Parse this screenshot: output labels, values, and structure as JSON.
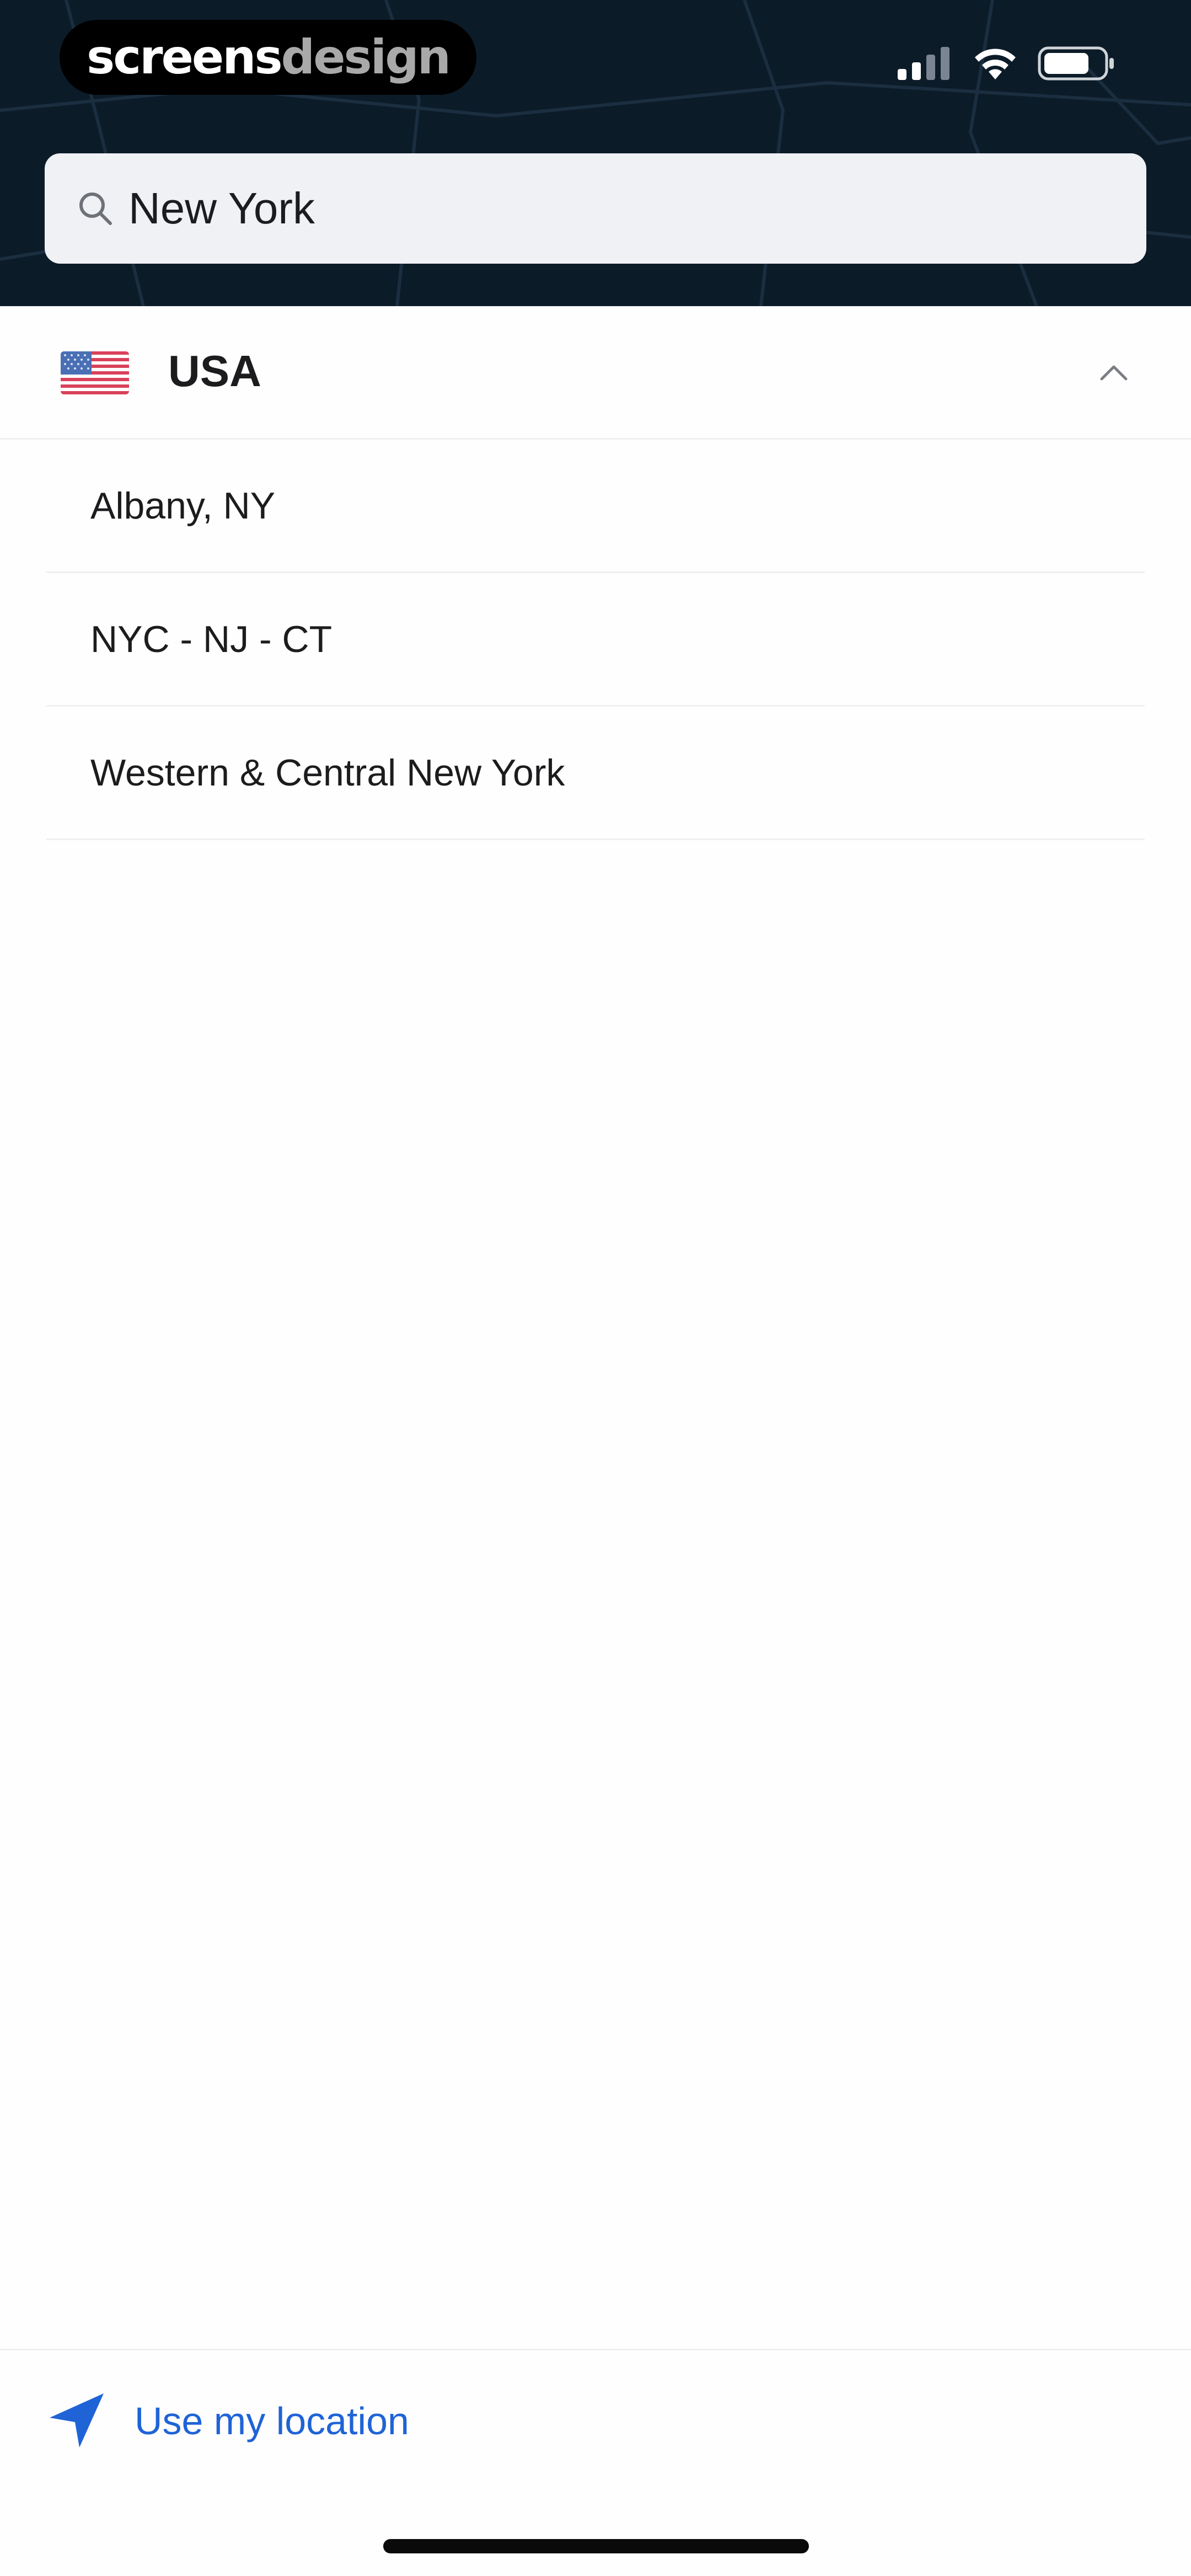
{
  "watermark": {
    "part1": "screens",
    "part2": "design"
  },
  "search": {
    "value": "New York",
    "placeholder": ""
  },
  "country": {
    "name": "USA",
    "flag": "us-flag-icon",
    "expanded": true
  },
  "regions": [
    {
      "label": "Albany, NY"
    },
    {
      "label": "NYC - NJ - CT"
    },
    {
      "label": "Western & Central New York"
    }
  ],
  "footer": {
    "location_label": "Use my location"
  },
  "colors": {
    "header_bg": "#0c1b28",
    "accent": "#1f63d6",
    "search_bg": "#f0f1f5"
  }
}
